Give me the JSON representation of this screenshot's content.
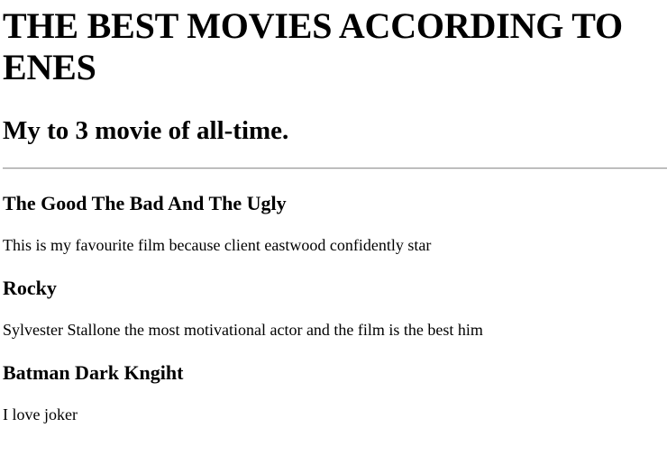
{
  "header": {
    "title": "THE BEST MOVIES ACCORDING TO ENES",
    "subtitle": "My to 3 movie of all-time."
  },
  "movies": [
    {
      "title": "The Good The Bad And The Ugly",
      "description": "This is my favourite film because client eastwood confidently star"
    },
    {
      "title": "Rocky",
      "description": "Sylvester Stallone the most motivational actor and the film is the best him"
    },
    {
      "title": "Batman Dark Kngiht",
      "description": "I love joker"
    }
  ]
}
